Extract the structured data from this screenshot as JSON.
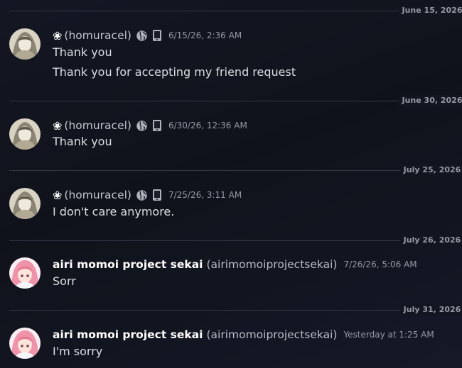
{
  "dividers": [
    "June 15, 2026",
    "June 30, 2026",
    "July 25, 2026",
    "July 26, 2026",
    "July 31, 2026"
  ],
  "messages": [
    {
      "author_flower": "❀",
      "author_username": "(homuracel)",
      "timestamp": "6/15/26, 2:36 AM",
      "lines": [
        "Thank you",
        "Thank you for accepting my friend request"
      ]
    },
    {
      "author_flower": "❀",
      "author_username": "(homuracel)",
      "timestamp": "6/30/26, 12:36 AM",
      "lines": [
        "Thank you"
      ]
    },
    {
      "author_flower": "❀",
      "author_username": "(homuracel)",
      "timestamp": "7/25/26, 3:11 AM",
      "lines": [
        "I don't care anymore."
      ]
    },
    {
      "author_display": "airi momoi project sekai",
      "author_username": "(airimomoiprojectsekai)",
      "timestamp": "7/26/26, 5:06 AM",
      "lines": [
        "Sorr"
      ]
    },
    {
      "author_display": "airi momoi project sekai",
      "author_username": "(airimomoiprojectsekai)",
      "timestamp": "Yesterday at 1:25 AM",
      "lines": [
        "I'm sorry"
      ]
    }
  ],
  "icons": {
    "globe": "globe-icon",
    "phone": "mobile-phone-icon"
  }
}
